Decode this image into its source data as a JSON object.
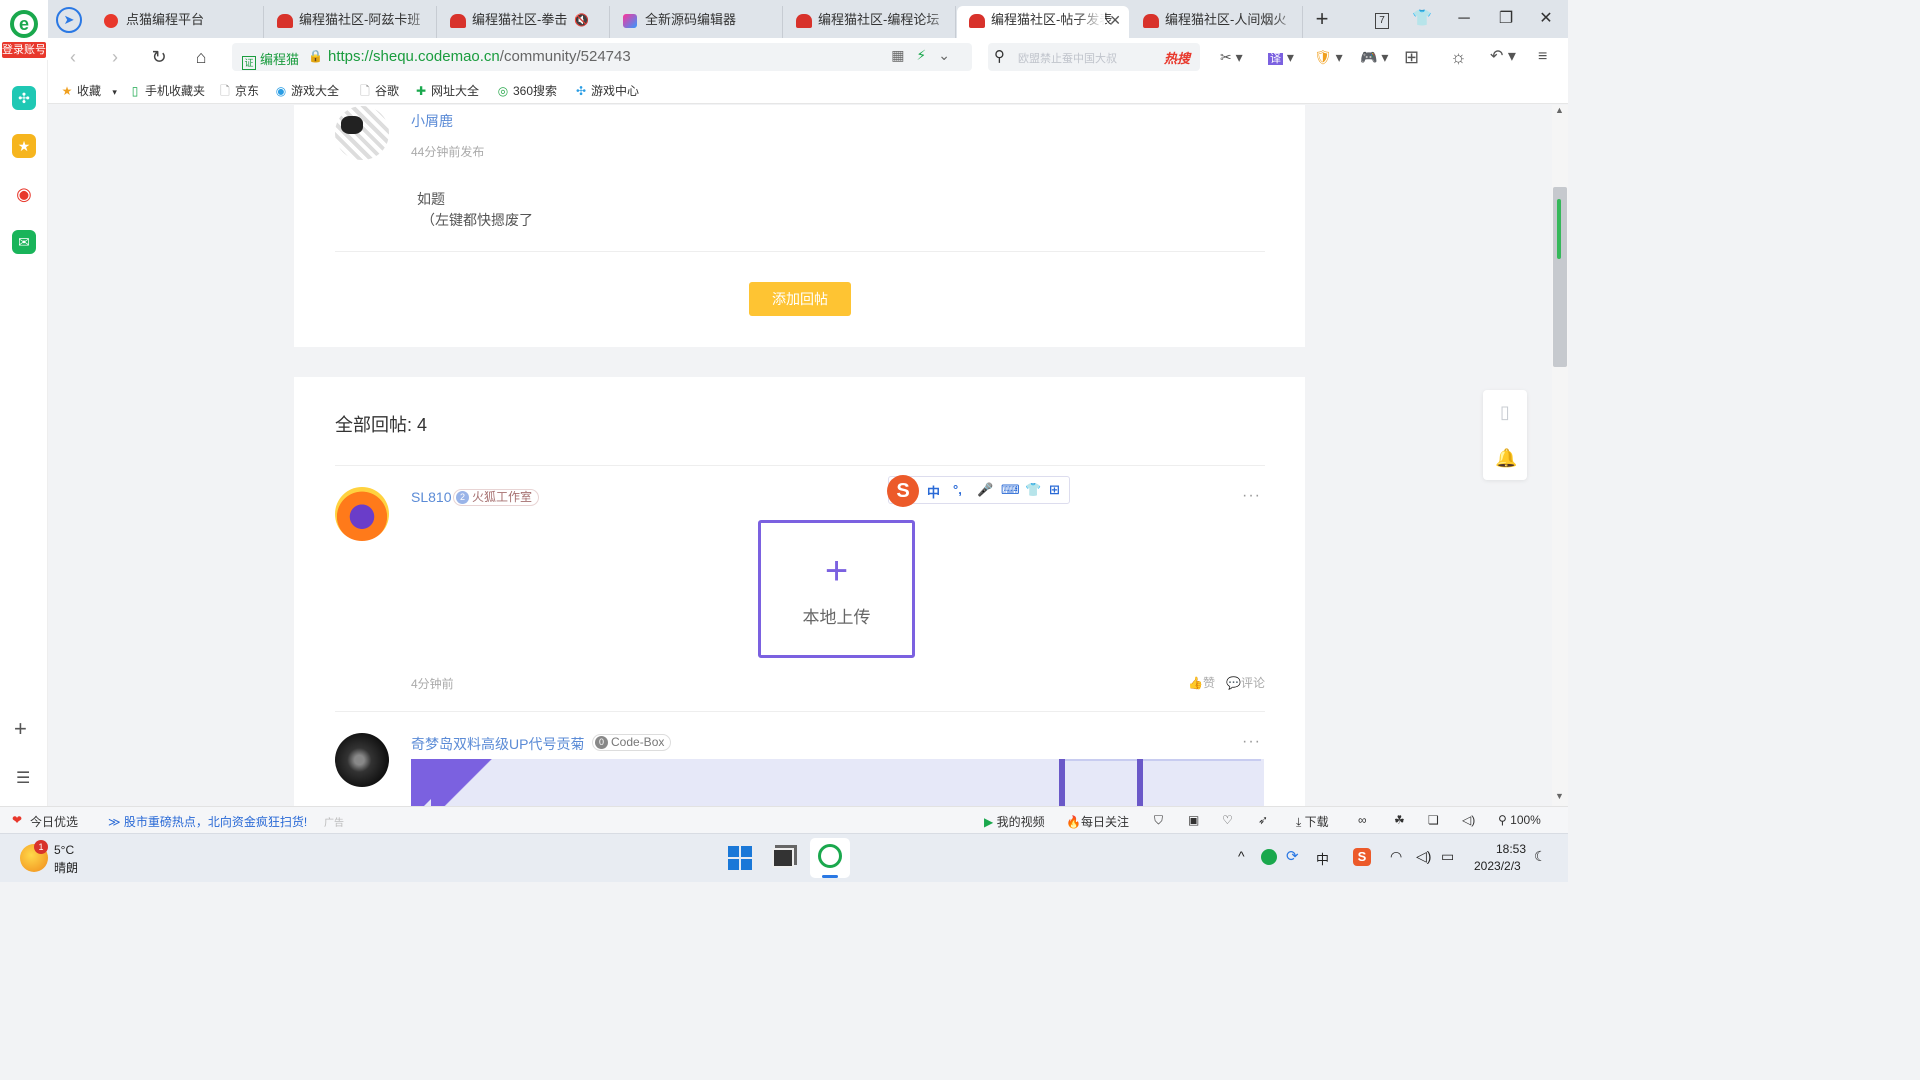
{
  "browser": {
    "logo_letter": "e",
    "login_label": "登录账号",
    "tabs": [
      {
        "title": "点猫编程平台"
      },
      {
        "title": "编程猫社区-阿兹卡班"
      },
      {
        "title": "编程猫社区-拳击"
      },
      {
        "title": "全新源码编辑器"
      },
      {
        "title": "编程猫社区-编程论坛"
      },
      {
        "title": "编程猫社区-帖子发表"
      },
      {
        "title": "编程猫社区-人间烟火"
      }
    ],
    "tab_count": "7",
    "new_tab": "+",
    "cert_label": "编程猫",
    "cert_icon_text": "证",
    "url_host": "https://shequ.codemao.cn",
    "url_path": "/community/524743",
    "search_placeholder": "欧盟禁止蚕中国大叔",
    "search_hot": "热搜",
    "zoom": "100%"
  },
  "bookmarks": [
    {
      "icon": "star-icon",
      "label": "收藏"
    },
    {
      "icon": "phone-icon",
      "label": "手机收藏夹"
    },
    {
      "icon": "page-icon",
      "label": "京东"
    },
    {
      "icon": "game-icon",
      "label": "游戏大全"
    },
    {
      "icon": "page-icon",
      "label": "谷歌"
    },
    {
      "icon": "link-icon",
      "label": "网址大全"
    },
    {
      "icon": "360-icon",
      "label": "360搜索"
    },
    {
      "icon": "gamepad-icon",
      "label": "游戏中心"
    }
  ],
  "post": {
    "author": "小屑鹿",
    "time": "44分钟前发布",
    "line1": "如题",
    "line2": "（左键都快摁废了",
    "add_reply": "添加回帖"
  },
  "replies": {
    "header": "全部回帖: 4",
    "items": [
      {
        "author": "SL810",
        "tag_num": "2",
        "tag": "火狐工作室",
        "time": "4分钟前",
        "like": "赞",
        "comment": "评论"
      },
      {
        "author": "奇梦岛双料高级UP代号贡菊",
        "tag_num": "0",
        "tag": "Code-Box"
      }
    ]
  },
  "upload": {
    "plus": "+",
    "label": "本地上传"
  },
  "ime": {
    "logo": "S",
    "items": [
      "中",
      "°,",
      "🎤",
      "⌨",
      "👕",
      "⊞"
    ]
  },
  "statusbar": {
    "today": "今日优选",
    "news": "股市重磅热点，北向资金疯狂扫货!",
    "ad": "广告",
    "my_video": "我的视频",
    "daily": "每日关注",
    "download": "下载",
    "zoom": "100%"
  },
  "taskbar": {
    "weather_temp": "5°C",
    "weather_desc": "晴朗",
    "weather_badge": "1",
    "time": "18:53",
    "date": "2023/2/3",
    "ime_lang": "中"
  },
  "colors": {
    "accent_green": "#1a9c3e",
    "reply_button": "#fec433",
    "upload_border": "#7b61e0",
    "link_blue": "#5b8bd6"
  }
}
